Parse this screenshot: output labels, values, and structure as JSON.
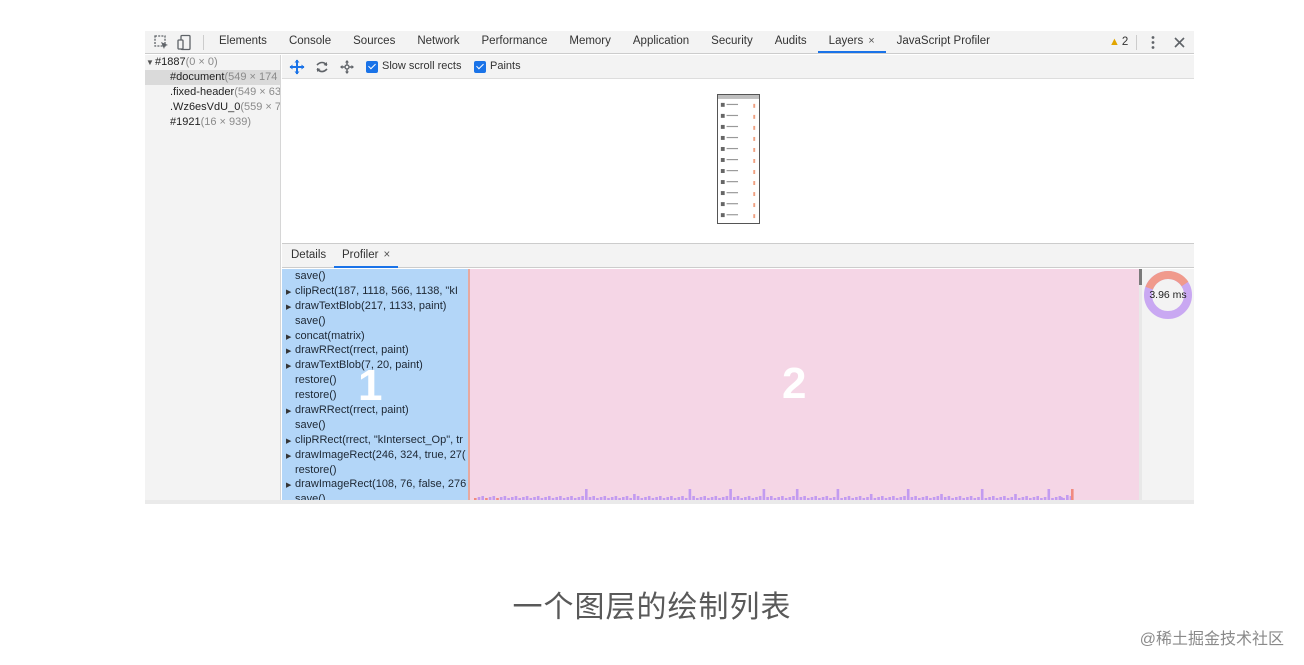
{
  "devtools": {
    "tabs": [
      {
        "label": "Elements"
      },
      {
        "label": "Console"
      },
      {
        "label": "Sources"
      },
      {
        "label": "Network"
      },
      {
        "label": "Performance"
      },
      {
        "label": "Memory"
      },
      {
        "label": "Application"
      },
      {
        "label": "Security"
      },
      {
        "label": "Audits"
      },
      {
        "label": "Layers",
        "active": true,
        "close": "×"
      },
      {
        "label": "JavaScript Profiler"
      }
    ],
    "warning_count": "2",
    "close_symbol": "✕"
  },
  "tree": {
    "root": {
      "name": "#1887",
      "size": "(0 × 0)"
    },
    "items": [
      {
        "name": "#document",
        "size": "(549 × 174"
      },
      {
        "name": ".fixed-header",
        "size": "(549 × 63"
      },
      {
        "name": ".Wz6esVdU_0",
        "size": "(559 × 7"
      },
      {
        "name": "#1921",
        "size": "(16 × 939)"
      }
    ]
  },
  "layers_toolbar": {
    "slow_scroll_rects": {
      "label": "Slow scroll rects",
      "checked": true
    },
    "paints": {
      "label": "Paints",
      "checked": true
    }
  },
  "details_tabs": {
    "details": "Details",
    "profiler": "Profiler",
    "profiler_close": "×"
  },
  "commands": [
    {
      "text": "save()",
      "expandable": false
    },
    {
      "text": "clipRect(187, 1118, 566, 1138, \"kI",
      "expandable": true
    },
    {
      "text": "drawTextBlob(217, 1133, paint)",
      "expandable": true
    },
    {
      "text": "save()",
      "expandable": false
    },
    {
      "text": "concat(matrix)",
      "expandable": true
    },
    {
      "text": "drawRRect(rrect, paint)",
      "expandable": true
    },
    {
      "text": "drawTextBlob(7, 20, paint)",
      "expandable": true
    },
    {
      "text": "restore()",
      "expandable": false
    },
    {
      "text": "restore()",
      "expandable": false
    },
    {
      "text": "drawRRect(rrect, paint)",
      "expandable": true
    },
    {
      "text": "save()",
      "expandable": false
    },
    {
      "text": "clipRRect(rrect, \"kIntersect_Op\", tr",
      "expandable": true
    },
    {
      "text": "drawImageRect(246, 324, true, 27(",
      "expandable": true
    },
    {
      "text": "restore()",
      "expandable": false
    },
    {
      "text": "drawImageRect(108, 76, false, 276",
      "expandable": true
    },
    {
      "text": "save()",
      "expandable": false
    }
  ],
  "annotations": {
    "commands_region": "1",
    "timeline_region": "2"
  },
  "profiler": {
    "total_time": "3.96 ms"
  },
  "colors": {
    "accent": "#1a73e8",
    "commands_bg": "#b3d6f8",
    "timeline_bg": "#f5d6e6",
    "bar_purple": "#c29bf0",
    "bar_red": "#f08a80"
  },
  "caption": "一个图层的绘制列表",
  "watermark": "@稀土掘金技术社区"
}
